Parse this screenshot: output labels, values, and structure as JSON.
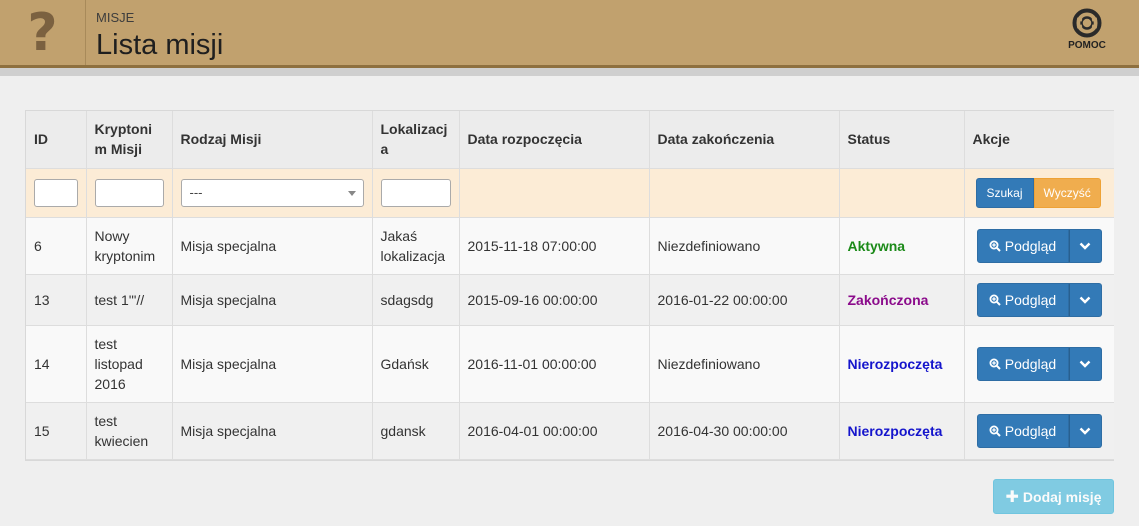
{
  "header": {
    "icon": "question-icon",
    "breadcrumb": "MISJE",
    "title": "Lista misji",
    "help_label": "POMOC",
    "help_icon": "lifebuoy-icon",
    "bg_color": "#c1a16e"
  },
  "table": {
    "columns": [
      "ID",
      "Kryptoni\nm Misji",
      "Rodzaj Misji",
      "Lokalizacj\na",
      "Data rozpoczęcia",
      "Data zakończenia",
      "Status",
      "Akcje"
    ],
    "filters": {
      "mission_type_selected": "---",
      "search_label": "Szukaj",
      "clear_label": "Wyczyść"
    },
    "rows": [
      {
        "id": "6",
        "codename": "Nowy\nkryptonim",
        "type": "Misja specjalna",
        "location": "Jakaś\nlokalizacja",
        "start": "2015-11-18 07:00:00",
        "end": "Niezdefiniowano",
        "status": "Aktywna",
        "status_color": "#1b8a18",
        "view_label": "Podgląd"
      },
      {
        "id": "13",
        "codename": "test 1'\"//",
        "type": "Misja specjalna",
        "location": "sdagsdg",
        "start": "2015-09-16 00:00:00",
        "end": "2016-01-22 00:00:00",
        "status": "Zakończona",
        "status_color": "#8b0b8b",
        "view_label": "Podgląd"
      },
      {
        "id": "14",
        "codename": "test\nlistopad\n2016",
        "type": "Misja specjalna",
        "location": "Gdańsk",
        "start": "2016-11-01 00:00:00",
        "end": "Niezdefiniowano",
        "status": "Nierozpoczęta",
        "status_color": "#1515cc",
        "view_label": "Podgląd"
      },
      {
        "id": "15",
        "codename": "test\nkwiecien",
        "type": "Misja specjalna",
        "location": "gdansk",
        "start": "2016-04-01 00:00:00",
        "end": "2016-04-30 00:00:00",
        "status": "Nierozpoczęta",
        "status_color": "#1515cc",
        "view_label": "Podgląd"
      }
    ]
  },
  "add_button": {
    "label": "Dodaj misję",
    "icon": "plus-icon"
  }
}
